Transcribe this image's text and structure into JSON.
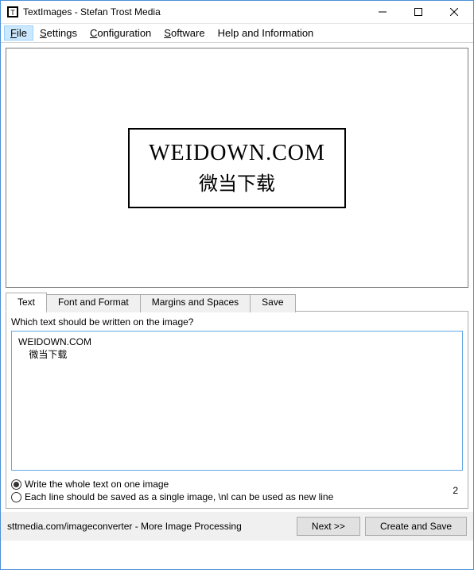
{
  "titlebar": {
    "title": "TextImages - Stefan Trost Media"
  },
  "menu": {
    "file": "File",
    "settings": "Settings",
    "configuration": "Configuration",
    "software": "Software",
    "help": "Help and Information"
  },
  "preview": {
    "line1": "WEIDOWN.COM",
    "line2": "微当下载"
  },
  "tabs": {
    "text": "Text",
    "font": "Font and Format",
    "margins": "Margins and Spaces",
    "save": "Save"
  },
  "content": {
    "question": "Which text should be written on the image?",
    "text_value": "WEIDOWN.COM\n    微当下载",
    "radio_whole": "Write the whole text on one image",
    "radio_each": "Each line should be saved as a single image, \\nl can be used as new line",
    "counter": "2"
  },
  "footer": {
    "link": "sttmedia.com/imageconverter - More Image Processing",
    "next": "Next >>",
    "create": "Create and Save"
  }
}
